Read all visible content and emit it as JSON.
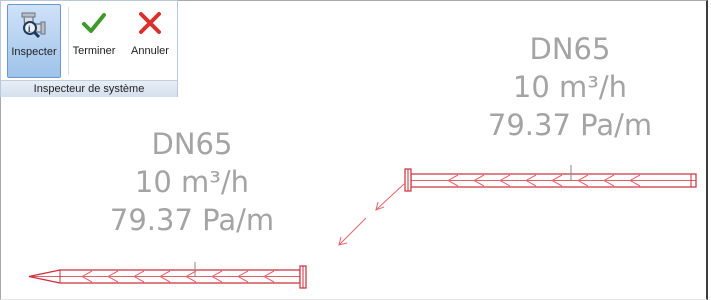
{
  "ribbon": {
    "inspect_label": "Inspecter",
    "finish_label": "Terminer",
    "cancel_label": "Annuler",
    "panel_title": "Inspecteur de système",
    "inspect_icon": "pipe-inspect-icon",
    "finish_icon": "check-icon",
    "cancel_icon": "x-icon"
  },
  "canvas": {
    "labels": [
      {
        "size": "DN65",
        "flow": "10 m³/h",
        "pressure": "79.37 Pa/m"
      },
      {
        "size": "DN65",
        "flow": "10 m³/h",
        "pressure": "79.37 Pa/m"
      }
    ],
    "colors": {
      "pipe": "#cc2d3a",
      "flow_arrow": "#e8646d",
      "label_text": "#a4a4a4"
    }
  }
}
